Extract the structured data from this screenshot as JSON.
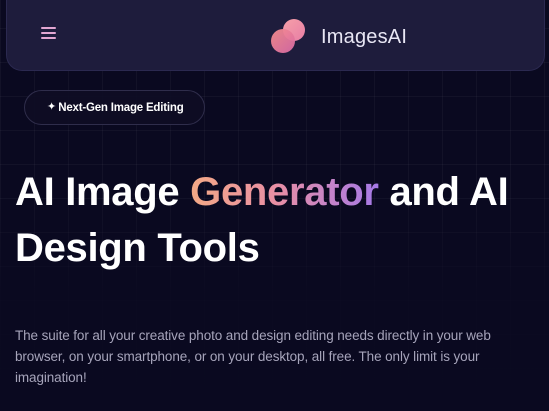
{
  "navbar": {
    "menu_icon": "hamburger-menu-icon",
    "brand_logo_icon": "imagesai-logo-icon",
    "brand_name": "ImagesAI"
  },
  "badge": {
    "icon": "sparkle-icon",
    "sparkle_glyph": "✦",
    "label": "Next-Gen Image Editing"
  },
  "hero": {
    "headline_part1": "AI Image ",
    "headline_highlight": "Generator",
    "headline_part2": " and AI Design Tools",
    "description": "The suite for all your creative photo and design editing needs directly in your web browser, on your smartphone, or on your desktop, all free. The only limit is your imagination!"
  },
  "colors": {
    "background": "#0a0920",
    "navbar": "#1e1c3c",
    "menu_icon": "#e2a6d2",
    "gradient_start": "#f3a986",
    "gradient_mid": "#e98fa4",
    "gradient_end": "#a579e8",
    "description_text": "#a6a4ba"
  }
}
